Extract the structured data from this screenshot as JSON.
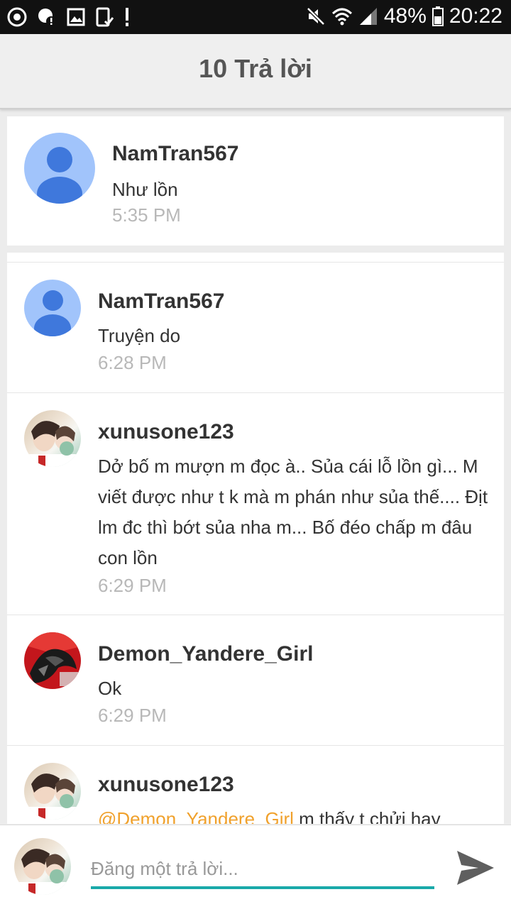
{
  "status_bar": {
    "battery_percent": "48%",
    "time": "20:22"
  },
  "header": {
    "title": "10 Trả lời"
  },
  "post": {
    "username": "NamTran567",
    "message": "Như lồn",
    "time": "5:35 PM",
    "avatar": "default-avatar-icon"
  },
  "replies": [
    {
      "username": "NamTran567",
      "message": "Truyện do",
      "time": "6:28 PM",
      "avatar": "default-avatar-icon"
    },
    {
      "username": "xunusone123",
      "message": "Dở bố m mượn m đọc à.. Sủa cái lỗ lồn gì... M viết được như t k mà m phán như sủa thế.... Địt lm đc thì bớt sủa nha m... Bố đéo chấp m đâu con lồn",
      "time": "6:29 PM",
      "avatar": "photo-avatar"
    },
    {
      "username": "Demon_Yandere_Girl",
      "message": "Ok",
      "time": "6:29 PM",
      "avatar": "anime-avatar"
    },
    {
      "username": "xunusone123",
      "mention": "@Demon_Yandere_Girl",
      "message": " m thấy t chửi hay",
      "avatar": "photo-avatar"
    }
  ],
  "composer": {
    "placeholder": "Đăng một trả lời...",
    "send_icon": "send-icon",
    "accent_color": "#1aa9a9"
  },
  "colors": {
    "mention": "#f0a12c",
    "avatar_bg": "#a1c4fb",
    "avatar_fg": "#3f78dc"
  }
}
